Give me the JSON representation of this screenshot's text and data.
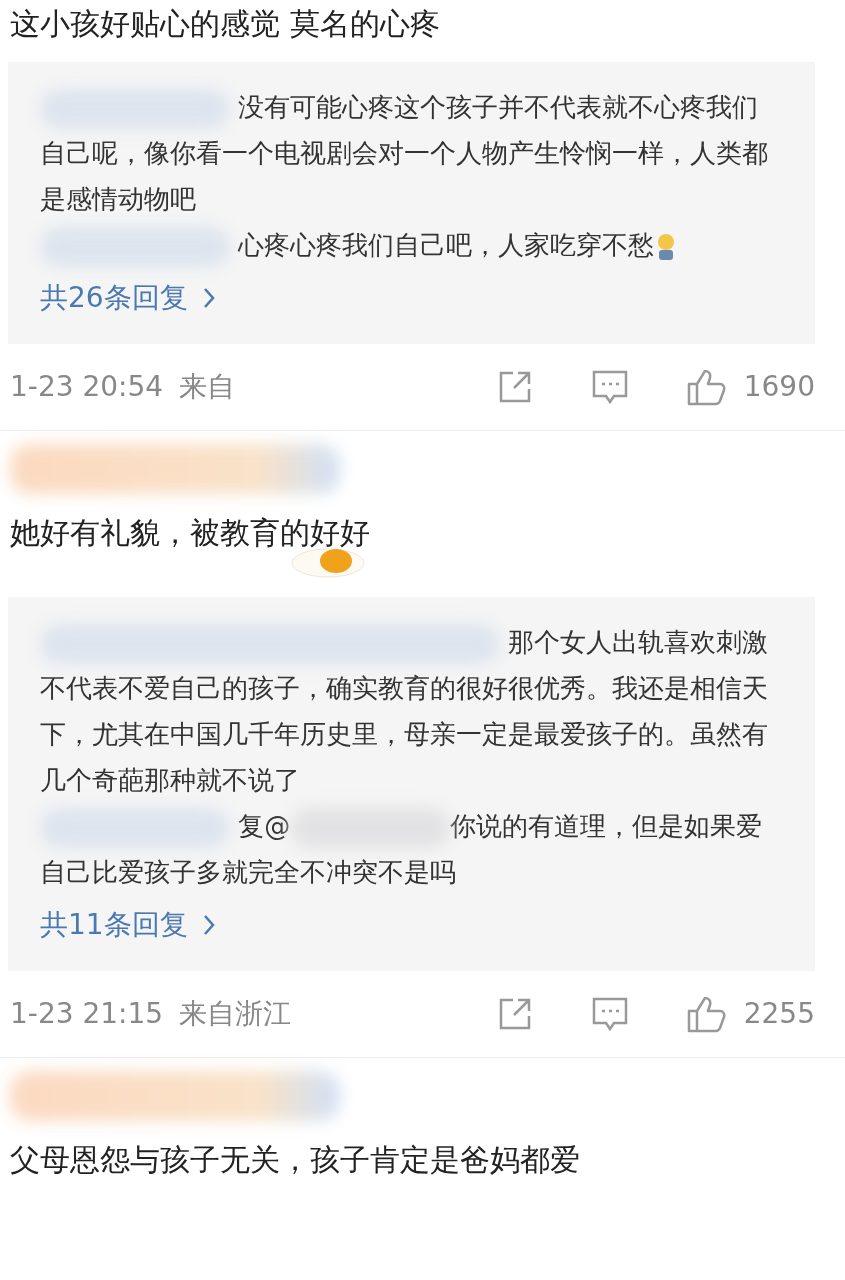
{
  "comments": [
    {
      "text": "这小孩好贴心的感觉 莫名的心疼",
      "sticker": false,
      "replies": [
        {
          "text": "没有可能心疼这个孩子并不代表就不心疼我们自己呢，像你看一个电视剧会对一个人物产生怜悯一样，人类都是感情动物吧",
          "emoji": false
        },
        {
          "text": "心疼心疼我们自己吧，人家吃穿不愁",
          "emoji": true
        }
      ],
      "reply_count": "共26条回复",
      "time": "1-23 20:54",
      "source": "来自",
      "likes": "1690"
    },
    {
      "text": "她好有礼貌，被教育的好好",
      "sticker": true,
      "replies": [
        {
          "text": "那个女人出轨喜欢刺激不代表不爱自己的孩子，确实教育的很好很优秀。我还是相信天下，尤其在中国几千年历史里，母亲一定是最爱孩子的。虽然有几个奇葩那种就不说了",
          "emoji": false
        },
        {
          "before": "复@",
          "text": "你说的有道理，但是如果爱自己比爱孩子多就完全不冲突不是吗",
          "emoji": false
        }
      ],
      "reply_count": "共11条回复",
      "time": "1-23 21:15",
      "source": "来自浙江",
      "likes": "2255"
    },
    {
      "text": "父母恩怨与孩子无关，孩子肯定是爸妈都爱",
      "sticker": false
    }
  ]
}
